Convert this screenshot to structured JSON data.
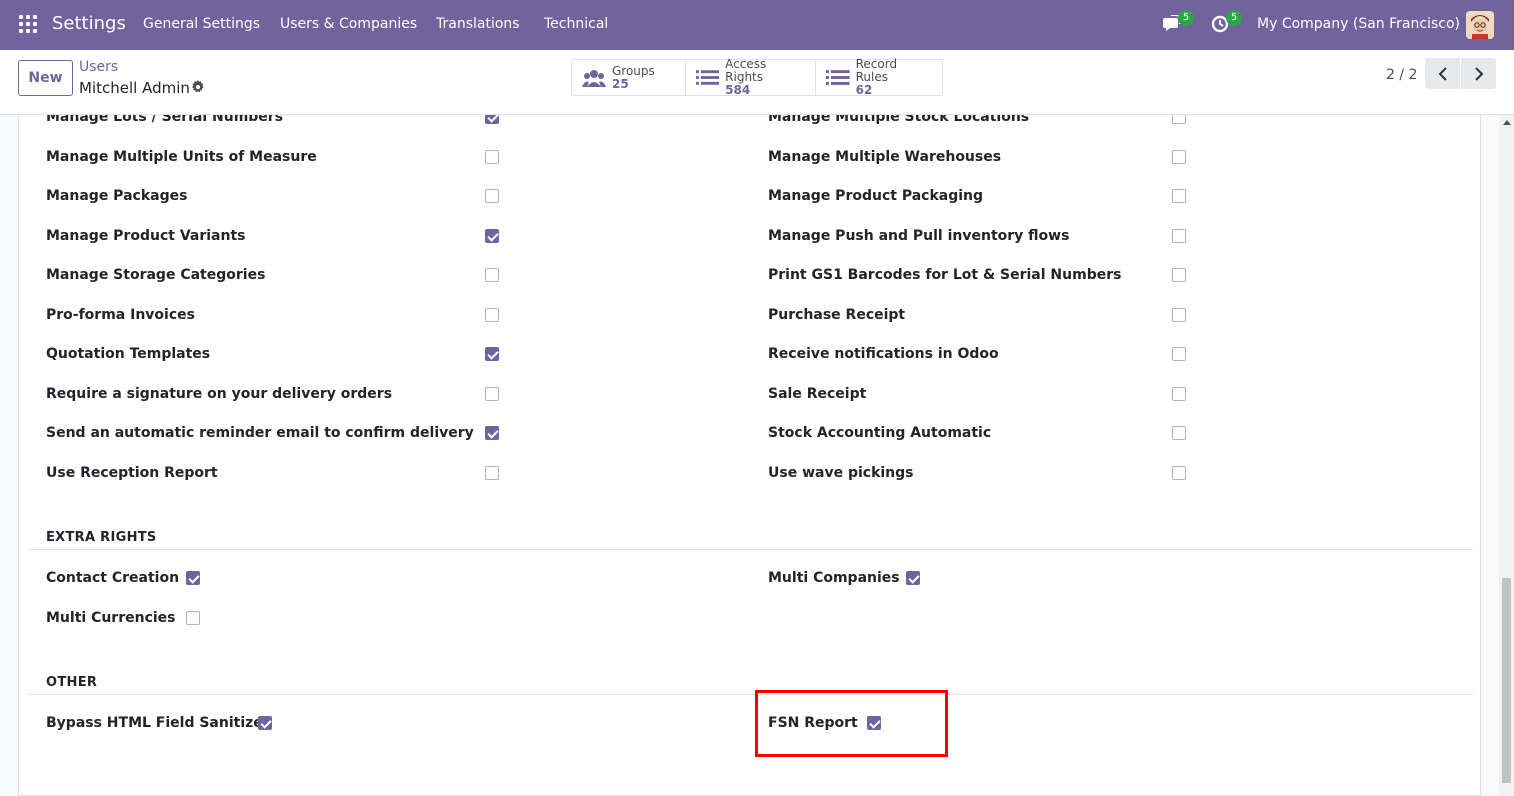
{
  "navbar": {
    "brand": "Settings",
    "menu": [
      "General Settings",
      "Users & Companies",
      "Translations",
      "Technical"
    ],
    "messages_count": "5",
    "activities_count": "5",
    "company": "My Company (San Francisco)"
  },
  "control_panel": {
    "new_label": "New",
    "breadcrumb_parent": "Users",
    "breadcrumb_current": "Mitchell Admin",
    "stats": [
      {
        "label": "Groups",
        "value": "25",
        "icon": "users-icon"
      },
      {
        "label": "Access Rights",
        "value": "584",
        "icon": "list-icon"
      },
      {
        "label": "Record Rules",
        "value": "62",
        "icon": "list-icon"
      }
    ],
    "pager": "2 / 2"
  },
  "technical_rows": {
    "left": [
      {
        "label": "Manage Lots / Serial Numbers",
        "checked": true
      },
      {
        "label": "Manage Multiple Units of Measure",
        "checked": false
      },
      {
        "label": "Manage Packages",
        "checked": false
      },
      {
        "label": "Manage Product Variants",
        "checked": true
      },
      {
        "label": "Manage Storage Categories",
        "checked": false
      },
      {
        "label": "Pro-forma Invoices",
        "checked": false
      },
      {
        "label": "Quotation Templates",
        "checked": true
      },
      {
        "label": "Require a signature on your delivery orders",
        "checked": false
      },
      {
        "label": "Send an automatic reminder email to confirm delivery",
        "checked": true
      },
      {
        "label": "Use Reception Report",
        "checked": false
      }
    ],
    "right": [
      {
        "label": "Manage Multiple Stock Locations",
        "checked": false
      },
      {
        "label": "Manage Multiple Warehouses",
        "checked": false
      },
      {
        "label": "Manage Product Packaging",
        "checked": false
      },
      {
        "label": "Manage Push and Pull inventory flows",
        "checked": false
      },
      {
        "label": "Print GS1 Barcodes for Lot & Serial Numbers",
        "checked": false
      },
      {
        "label": "Purchase Receipt",
        "checked": false
      },
      {
        "label": "Receive notifications in Odoo",
        "checked": false
      },
      {
        "label": "Sale Receipt",
        "checked": false
      },
      {
        "label": "Stock Accounting Automatic",
        "checked": false
      },
      {
        "label": "Use wave pickings",
        "checked": false
      }
    ]
  },
  "extra_rights": {
    "title": "EXTRA RIGHTS",
    "items": [
      {
        "label": "Contact Creation",
        "checked": true
      },
      {
        "label": "Multi Companies",
        "checked": true
      },
      {
        "label": "Multi Currencies",
        "checked": false
      }
    ]
  },
  "other": {
    "title": "OTHER",
    "items": [
      {
        "label": "Bypass HTML Field Sanitize",
        "checked": true
      },
      {
        "label": "FSN Report",
        "checked": true
      }
    ]
  },
  "colors": {
    "brand": "#71639e",
    "highlight": "#ff0000",
    "badge": "#28a745"
  }
}
